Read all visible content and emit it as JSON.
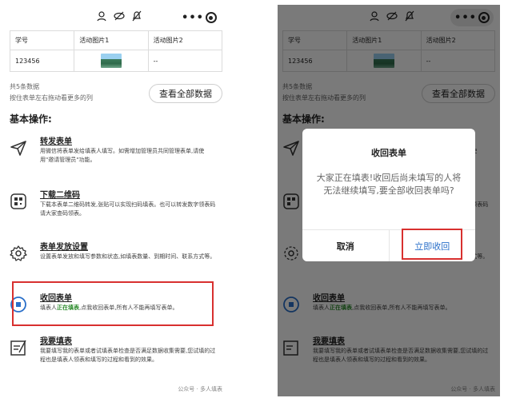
{
  "table": {
    "headers": [
      "学号",
      "活动图片1",
      "活动图片2"
    ],
    "row": {
      "id": "123456",
      "img2": "--"
    }
  },
  "summary": {
    "count": "共5条数据",
    "hint": "按住表单左右拖动看更多的列"
  },
  "view_all_label": "查看全部数据",
  "ops_title": "基本操作:",
  "operations": [
    {
      "title": "转发表单",
      "desc": "用微信将表单发给填表人填写。如需增加管理员共同管理表单,请使用\"邀请管理员\"功能。"
    },
    {
      "title": "下载二维码",
      "desc": "下载本表单二维码转发,张贴可以实现扫码填表。也可以转发数字领表码请大家查码领表。"
    },
    {
      "title": "表单发放设置",
      "desc": "设置表单发放和填写参数和状态,如填表数量、到期时间、联系方式等。"
    },
    {
      "title": "收回表单",
      "desc_prefix": "填表人",
      "desc_highlight": "正在填表",
      "desc_suffix": ",点我收回表单,所有人不能再填写表单。"
    },
    {
      "title": "我要填表",
      "desc": "我要填写我的表单或者试填表单检查是否满足数据收集需要,您试填的过程也是填表人领表和填写的过程和看到的效果。"
    }
  ],
  "watermark": "公众号 · 多人填表",
  "dialog": {
    "title": "收回表单",
    "message": "大家正在填表!收回后尚未填写的人将无法继续填写,要全部收回表单吗?",
    "cancel_label": "取消",
    "confirm_label": "立即收回"
  },
  "colors": {
    "highlight_box": "#d8302f",
    "accent": "#2a6fc9",
    "hl_green": "#2a8a2a"
  }
}
